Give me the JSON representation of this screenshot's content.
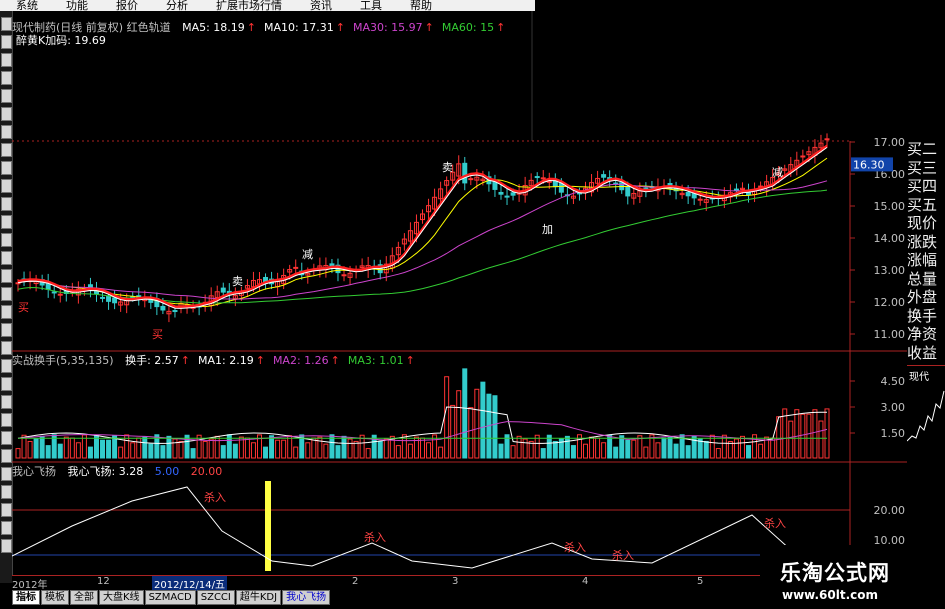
{
  "menu": [
    "系统",
    "功能",
    "报价",
    "分析",
    "扩展市场行情",
    "资讯",
    "工具",
    "帮助"
  ],
  "main_title": "现代制药(日线 前复权) 红色轨道",
  "ma_labels": [
    {
      "text": "MA5: 18.19",
      "color": "#ffffff"
    },
    {
      "text": "MA10: 17.31",
      "color": "#ffffff"
    },
    {
      "text": "MA30: 15.97",
      "color": "#cc44cc"
    },
    {
      "text": "MA60: 15",
      "color": "#33cc33"
    }
  ],
  "sub_title": "醉黄K加码: 19.69",
  "price_badge": "16.30",
  "price_ticks": [
    "17.00",
    "16.00",
    "15.00",
    "14.00",
    "13.00",
    "12.00",
    "11.00"
  ],
  "markers": {
    "sell": "卖",
    "buy": "买",
    "add": "加",
    "reduce": "减"
  },
  "vol_title": {
    "name": "实战换手(5,35,135)",
    "items": [
      {
        "text": "换手: 2.57",
        "color": "#ffffff"
      },
      {
        "text": "MA1: 2.19",
        "color": "#ffffff"
      },
      {
        "text": "MA2: 1.26",
        "color": "#cc44cc"
      },
      {
        "text": "MA3: 1.01",
        "color": "#33cc33"
      }
    ]
  },
  "vol_ticks": [
    "4.50",
    "3.00",
    "1.50"
  ],
  "ind_title": {
    "name": "我心飞扬",
    "value": "我心飞扬: 3.28",
    "s1": "5.00",
    "s2": "20.00"
  },
  "ind_ticks": [
    "20.00",
    "10.00"
  ],
  "ind_labels": [
    "杀入",
    "杀入",
    "杀入",
    "杀入",
    "杀入"
  ],
  "sidebar": [
    "买二",
    "买三",
    "买四",
    "买五",
    "现价",
    "涨跌",
    "涨幅",
    "总量",
    "外盘",
    "换手",
    "净资",
    "收益"
  ],
  "mini_label": "现代",
  "time_axis": [
    "2012年",
    "12",
    "2012/12/14/五",
    "2",
    "3",
    "4",
    "5"
  ],
  "tabs": [
    "指标",
    "模板",
    "全部",
    "大盘K线",
    "SZMACD",
    "SZCCI",
    "超牛KDJ",
    "我心飞扬"
  ],
  "watermark": {
    "title": "乐淘公式网",
    "url": "www.60lt.com"
  },
  "colors": {
    "up": "#ff3333",
    "down": "#33cccc",
    "ma5": "#ffffff",
    "ma10": "#ffff00",
    "ma30": "#cc44cc",
    "ma60": "#33cc33",
    "red_line": "#ff2020"
  }
}
